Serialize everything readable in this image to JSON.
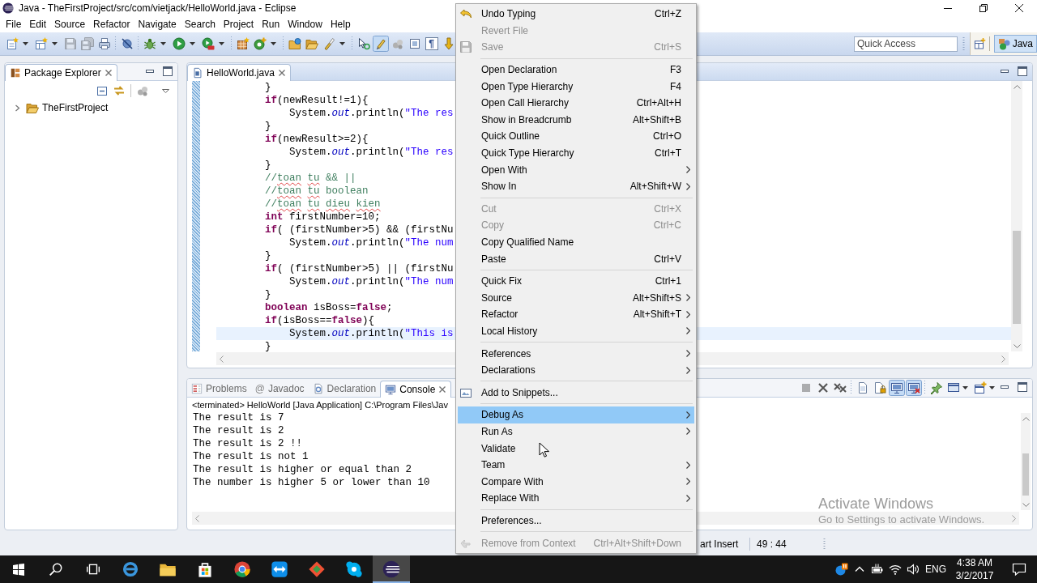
{
  "window": {
    "title": "Java - TheFirstProject/src/com/vietjack/HelloWorld.java - Eclipse"
  },
  "menu_bar": [
    "File",
    "Edit",
    "Source",
    "Refactor",
    "Navigate",
    "Search",
    "Project",
    "Run",
    "Window",
    "Help"
  ],
  "toolbar": {
    "groups": [
      [
        {
          "dropdown": true,
          "disabled": false,
          "pressed": false
        },
        {
          "dropdown": true,
          "disabled": false,
          "pressed": false
        },
        {
          "disabled": true,
          "pressed": false
        },
        {
          "disabled": true,
          "pressed": false
        },
        {
          "disabled": false,
          "pressed": false
        }
      ],
      [
        {
          "disabled": false,
          "pressed": false
        }
      ],
      [
        {
          "dropdown": true,
          "disabled": false,
          "pressed": false
        },
        {
          "dropdown": true,
          "disabled": false,
          "pressed": false
        },
        {
          "dropdown": true,
          "disabled": false,
          "pressed": false
        }
      ],
      [
        {
          "disabled": false,
          "pressed": false
        },
        {
          "dropdown": true,
          "disabled": false,
          "pressed": false
        }
      ],
      [
        {
          "disabled": false,
          "pressed": false
        },
        {
          "disabled": false,
          "pressed": false
        },
        {
          "dropdown": true,
          "disabled": false,
          "pressed": false
        }
      ],
      [
        {
          "disabled": false,
          "pressed": false
        },
        {
          "disabled": false,
          "pressed": true
        },
        {
          "disabled": false,
          "pressed": false
        },
        {
          "disabled": false,
          "pressed": false
        },
        {
          "glyph": "¶",
          "disabled": false,
          "pressed": false
        },
        {
          "disabled": false,
          "pressed": false
        }
      ]
    ],
    "quick_access": {
      "placeholder": "Quick Access"
    },
    "perspectives": [
      {
        "label": "Java",
        "selected": true
      }
    ]
  },
  "package_explorer": {
    "tabs": [
      {
        "label": "Package Explorer",
        "selected": true
      }
    ],
    "tree": [
      {
        "label": "TheFirstProject",
        "expanded": false
      }
    ]
  },
  "editor": {
    "tabs": [
      {
        "label": "HelloWorld.java",
        "selected": true
      }
    ],
    "lines": [
      {
        "current": false,
        "tokens": [
          {
            "kind": "plain",
            "text": "}"
          }
        ]
      },
      {
        "current": false,
        "tokens": [
          {
            "kind": "keyword",
            "text": "if"
          },
          {
            "kind": "plain",
            "text": "(newResult!=1){"
          }
        ],
        "children": [
          {
            "current": false,
            "tokens": [
              {
                "kind": "plain",
                "text": "System."
              },
              {
                "kind": "field",
                "text": "out"
              },
              {
                "kind": "plain",
                "text": ".println("
              },
              {
                "kind": "string",
                "text": "\"The res"
              }
            ]
          }
        ]
      },
      {
        "current": false,
        "tokens": [
          {
            "kind": "plain",
            "text": "}"
          }
        ]
      },
      {
        "current": false,
        "tokens": [
          {
            "kind": "keyword",
            "text": "if"
          },
          {
            "kind": "plain",
            "text": "(newResult>=2){"
          }
        ],
        "children": [
          {
            "current": false,
            "tokens": [
              {
                "kind": "plain",
                "text": "System."
              },
              {
                "kind": "field",
                "text": "out"
              },
              {
                "kind": "plain",
                "text": ".println("
              },
              {
                "kind": "string",
                "text": "\"The res"
              }
            ]
          }
        ]
      },
      {
        "current": false,
        "tokens": [
          {
            "kind": "plain",
            "text": "}"
          }
        ]
      },
      {
        "current": false,
        "tokens": [
          {
            "kind": "comment",
            "text": "//"
          },
          {
            "kind": "misspelled",
            "text": "toan"
          },
          {
            "kind": "misspelled",
            "text": " tu"
          },
          {
            "kind": "comment",
            "text": " && ||"
          }
        ]
      },
      {
        "current": false,
        "tokens": [
          {
            "kind": "comment",
            "text": "//"
          },
          {
            "kind": "misspelled",
            "text": "toan"
          },
          {
            "kind": "misspelled",
            "text": " tu"
          },
          {
            "kind": "comment",
            "text": " boolean"
          }
        ]
      },
      {
        "current": false,
        "tokens": [
          {
            "kind": "comment",
            "text": "//"
          },
          {
            "kind": "misspelled",
            "text": "toan"
          },
          {
            "kind": "misspelled",
            "text": " tu"
          },
          {
            "kind": "misspelled",
            "text": " dieu"
          },
          {
            "kind": "misspelled",
            "text": " kien"
          }
        ]
      },
      {
        "current": false,
        "tokens": [
          {
            "kind": "keyword",
            "text": "int"
          },
          {
            "kind": "plain",
            "text": " firstNumber=10;"
          }
        ]
      },
      {
        "current": false,
        "tokens": [
          {
            "kind": "keyword",
            "text": "if"
          },
          {
            "kind": "plain",
            "text": "( (firstNumber>5) && (firstNu"
          }
        ],
        "children": [
          {
            "current": false,
            "tokens": [
              {
                "kind": "plain",
                "text": "System."
              },
              {
                "kind": "field",
                "text": "out"
              },
              {
                "kind": "plain",
                "text": ".println("
              },
              {
                "kind": "string",
                "text": "\"The num"
              }
            ]
          }
        ]
      },
      {
        "current": false,
        "tokens": [
          {
            "kind": "plain",
            "text": "}"
          }
        ]
      },
      {
        "current": false,
        "tokens": [
          {
            "kind": "keyword",
            "text": "if"
          },
          {
            "kind": "plain",
            "text": "( (firstNumber>5) || (firstNu"
          }
        ],
        "children": [
          {
            "current": false,
            "tokens": [
              {
                "kind": "plain",
                "text": "System."
              },
              {
                "kind": "field",
                "text": "out"
              },
              {
                "kind": "plain",
                "text": ".println("
              },
              {
                "kind": "string",
                "text": "\"The num"
              }
            ]
          }
        ]
      },
      {
        "current": false,
        "tokens": [
          {
            "kind": "plain",
            "text": "}"
          }
        ]
      },
      {
        "current": false,
        "tokens": [
          {
            "kind": "keyword",
            "text": "boolean"
          },
          {
            "kind": "plain",
            "text": " isBoss="
          },
          {
            "kind": "keyword",
            "text": "false"
          },
          {
            "kind": "plain",
            "text": ";"
          }
        ]
      },
      {
        "current": false,
        "tokens": [
          {
            "kind": "keyword",
            "text": "if"
          },
          {
            "kind": "plain",
            "text": "(isBoss=="
          },
          {
            "kind": "keyword",
            "text": "false"
          },
          {
            "kind": "plain",
            "text": "){"
          }
        ],
        "children": [
          {
            "current": true,
            "tokens": [
              {
                "kind": "plain",
                "text": "System."
              },
              {
                "kind": "field",
                "text": "out"
              },
              {
                "kind": "plain",
                "text": ".println("
              },
              {
                "kind": "string",
                "text": "\"This is"
              }
            ]
          }
        ]
      },
      {
        "current": false,
        "tokens": [
          {
            "kind": "plain",
            "text": "}"
          }
        ]
      }
    ]
  },
  "console": {
    "tabs": [
      {
        "label": "Problems",
        "selected": false
      },
      {
        "glyph": "@",
        "label": "Javadoc",
        "selected": false
      },
      {
        "label": "Declaration",
        "selected": false
      },
      {
        "label": "Console",
        "selected": true
      }
    ],
    "toolbar": {
      "groups": [
        [
          {
            "disabled": true,
            "pressed": false
          },
          {
            "disabled": false,
            "pressed": false
          },
          {
            "disabled": false,
            "pressed": false
          }
        ],
        [
          {
            "disabled": false,
            "pressed": false
          },
          {
            "disabled": false,
            "pressed": false
          },
          {
            "disabled": false,
            "pressed": true
          },
          {
            "disabled": false,
            "pressed": true
          }
        ],
        [
          {
            "disabled": false,
            "pressed": false
          },
          {
            "dropdown": true,
            "disabled": false,
            "pressed": false
          },
          {
            "dropdown": true,
            "disabled": false,
            "pressed": false
          }
        ]
      ]
    },
    "process": "<terminated> HelloWorld [Java Application] C:\\Program Files\\Jav",
    "output": [
      "The result is 7",
      "The result is 2",
      "The result is 2 !!",
      "The result is not 1",
      "The result is higher or equal than 2",
      "The number is higher 5 or lower than 10"
    ]
  },
  "context_menu": {
    "groups": [
      [
        {
          "label": "Undo Typing",
          "shortcut": "Ctrl+Z",
          "disabled": false,
          "submenu": false,
          "selected": false
        },
        {
          "label": "Revert File",
          "disabled": true,
          "submenu": false,
          "selected": false
        },
        {
          "label": "Save",
          "shortcut": "Ctrl+S",
          "disabled": true,
          "submenu": false,
          "selected": false
        }
      ],
      [
        {
          "label": "Open Declaration",
          "shortcut": "F3",
          "disabled": false,
          "submenu": false,
          "selected": false
        },
        {
          "label": "Open Type Hierarchy",
          "shortcut": "F4",
          "disabled": false,
          "submenu": false,
          "selected": false
        },
        {
          "label": "Open Call Hierarchy",
          "shortcut": "Ctrl+Alt+H",
          "disabled": false,
          "submenu": false,
          "selected": false
        },
        {
          "label": "Show in Breadcrumb",
          "shortcut": "Alt+Shift+B",
          "disabled": false,
          "submenu": false,
          "selected": false
        },
        {
          "label": "Quick Outline",
          "shortcut": "Ctrl+O",
          "disabled": false,
          "submenu": false,
          "selected": false
        },
        {
          "label": "Quick Type Hierarchy",
          "shortcut": "Ctrl+T",
          "disabled": false,
          "submenu": false,
          "selected": false
        },
        {
          "label": "Open With",
          "disabled": false,
          "submenu": true,
          "selected": false
        },
        {
          "label": "Show In",
          "shortcut": "Alt+Shift+W",
          "disabled": false,
          "submenu": true,
          "selected": false
        }
      ],
      [
        {
          "label": "Cut",
          "shortcut": "Ctrl+X",
          "disabled": true,
          "submenu": false,
          "selected": false
        },
        {
          "label": "Copy",
          "shortcut": "Ctrl+C",
          "disabled": true,
          "submenu": false,
          "selected": false
        },
        {
          "label": "Copy Qualified Name",
          "disabled": false,
          "submenu": false,
          "selected": false
        },
        {
          "label": "Paste",
          "shortcut": "Ctrl+V",
          "disabled": false,
          "submenu": false,
          "selected": false
        }
      ],
      [
        {
          "label": "Quick Fix",
          "shortcut": "Ctrl+1",
          "disabled": false,
          "submenu": false,
          "selected": false
        },
        {
          "label": "Source",
          "shortcut": "Alt+Shift+S",
          "disabled": false,
          "submenu": true,
          "selected": false
        },
        {
          "label": "Refactor",
          "shortcut": "Alt+Shift+T",
          "disabled": false,
          "submenu": true,
          "selected": false
        },
        {
          "label": "Local History",
          "disabled": false,
          "submenu": true,
          "selected": false
        }
      ],
      [
        {
          "label": "References",
          "disabled": false,
          "submenu": true,
          "selected": false
        },
        {
          "label": "Declarations",
          "disabled": false,
          "submenu": true,
          "selected": false
        }
      ],
      [
        {
          "label": "Add to Snippets...",
          "disabled": false,
          "submenu": false,
          "selected": false
        }
      ],
      [
        {
          "label": "Debug As",
          "disabled": false,
          "submenu": true,
          "selected": true
        },
        {
          "label": "Run As",
          "disabled": false,
          "submenu": true,
          "selected": false
        },
        {
          "label": "Validate",
          "disabled": false,
          "submenu": false,
          "selected": false
        },
        {
          "label": "Team",
          "disabled": false,
          "submenu": true,
          "selected": false
        },
        {
          "label": "Compare With",
          "disabled": false,
          "submenu": true,
          "selected": false
        },
        {
          "label": "Replace With",
          "disabled": false,
          "submenu": true,
          "selected": false
        }
      ],
      [
        {
          "label": "Preferences...",
          "disabled": false,
          "submenu": false,
          "selected": false
        }
      ],
      [
        {
          "label": "Remove from Context",
          "shortcut": "Ctrl+Alt+Shift+Down",
          "disabled": true,
          "submenu": false,
          "selected": false
        }
      ]
    ]
  },
  "status_bar": [
    "art Insert",
    "49 : 44"
  ],
  "activation_notice": {
    "title": "Activate Windows",
    "subtitle": "Go to Settings to activate Windows."
  },
  "taskbar": {
    "apps": [
      {
        "active": false
      },
      {
        "active": false
      },
      {
        "active": false
      },
      {
        "active": false
      },
      {
        "active": false
      },
      {
        "active": false
      },
      {
        "active": false
      },
      {
        "active": false
      },
      {
        "active": false
      },
      {
        "active": false
      },
      {
        "active": true
      }
    ],
    "tray": {
      "language": "ENG",
      "time": "4:38 AM",
      "date": "3/2/2017"
    }
  }
}
